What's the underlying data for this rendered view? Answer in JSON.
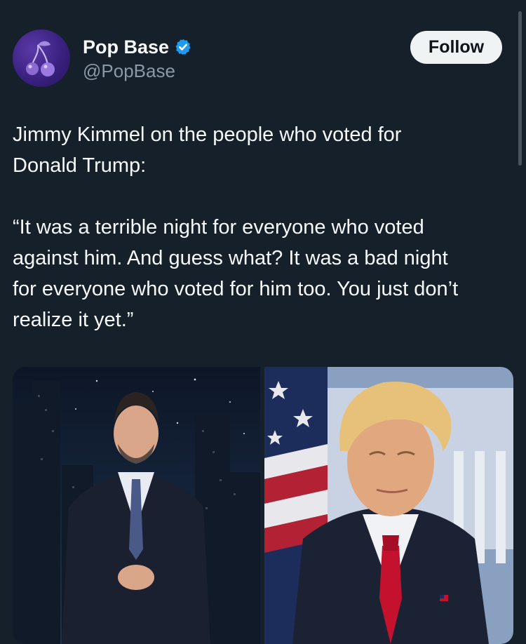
{
  "account": {
    "display_name": "Pop Base",
    "handle": "@PopBase",
    "verified_icon": "verified-badge-icon",
    "avatar_icon": "cherries-icon"
  },
  "follow": {
    "label": "Follow"
  },
  "tweet": {
    "lines": [
      "Jimmy Kimmel on the people who voted for",
      "Donald Trump:",
      "",
      "“It was a terrible night for everyone who voted",
      "against him. And guess what? It was a bad night",
      "for everyone who voted for him too. You just don’t",
      "realize it yet.”"
    ]
  },
  "colors": {
    "background": "#15202b",
    "text": "#f7f9f9",
    "secondary_text": "#8b98a5",
    "verified": "#1d9bf0",
    "follow_bg": "#eff3f4"
  }
}
